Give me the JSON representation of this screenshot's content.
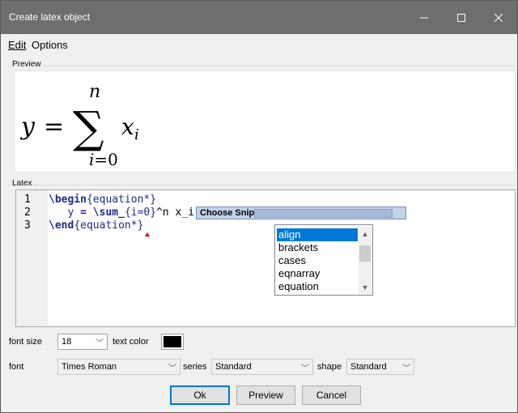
{
  "window": {
    "title": "Create latex object"
  },
  "menu": {
    "edit": "Edit",
    "options": "Options"
  },
  "preview": {
    "label": "Preview",
    "formula": "y = \\sum_{i=0}^n x_i"
  },
  "latex": {
    "label": "Latex",
    "line_numbers": [
      "1",
      "2",
      "3"
    ],
    "lines": [
      [
        "\\begin",
        "{equation*}"
      ],
      [
        "y",
        "=",
        "\\sum_",
        "{i=0}",
        "^n x_",
        "i"
      ],
      [
        "\\end",
        "{equation*}"
      ]
    ]
  },
  "snippet": {
    "title": "Choose Snipp",
    "items": [
      "align",
      "brackets",
      "cases",
      "eqnarray",
      "equation"
    ],
    "selected": "align"
  },
  "controls": {
    "font_size_label": "font size",
    "font_size_value": "18",
    "text_color_label": "text color",
    "text_color": "#000000",
    "font_label": "font",
    "font_value": "Times Roman",
    "series_label": "series",
    "series_value": "Standard",
    "shape_label": "shape",
    "shape_value": "Standard"
  },
  "buttons": {
    "ok": "Ok",
    "preview": "Preview",
    "cancel": "Cancel"
  },
  "colors": {
    "accent": "#0078d7",
    "titlebar": "#6e6e6e",
    "keyword": "#1f2a8a"
  }
}
